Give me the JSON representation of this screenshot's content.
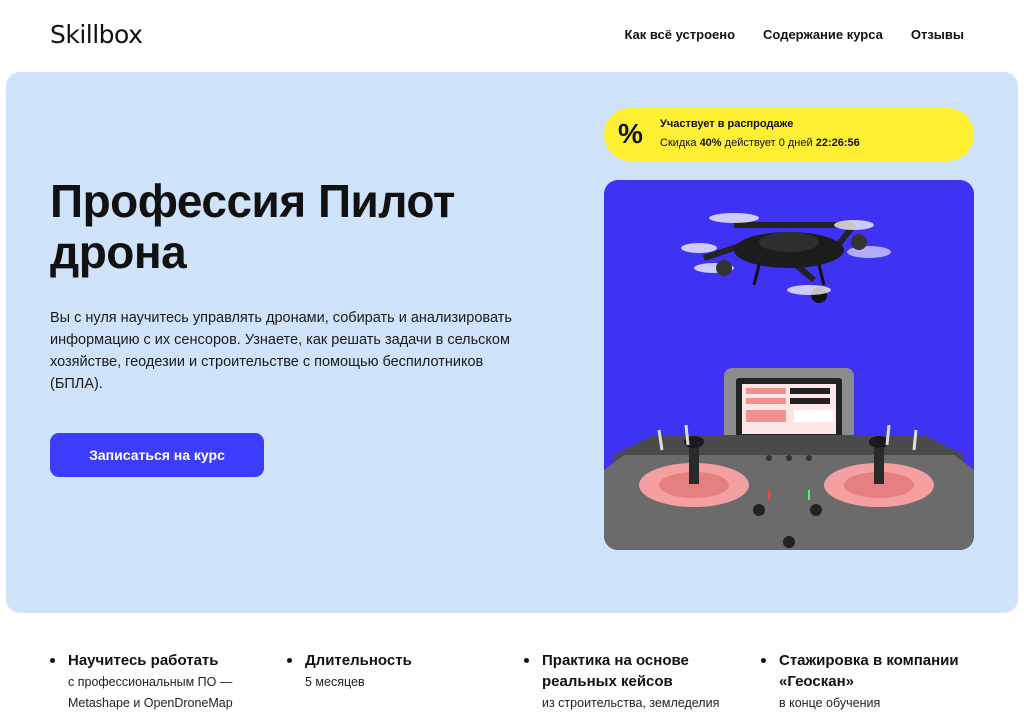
{
  "header": {
    "logo": "Skillbox",
    "nav": [
      {
        "label": "Как всё устроено"
      },
      {
        "label": "Содержание курса"
      },
      {
        "label": "Отзывы"
      }
    ]
  },
  "hero": {
    "title": "Профессия Пилот дрона",
    "description": "Вы с нуля научитесь управлять дронами, собирать и анализировать информацию с их сенсоров. Узнаете, как решать задачи в сельском хозяйстве, геодезии и строительстве с помощью беспилотников (БПЛА).",
    "cta_label": "Записаться на курс",
    "background_color": "#cfe4fb",
    "cta_color": "#3d3dff"
  },
  "sale": {
    "icon": "percent-icon",
    "line1": "Участвует в распродаже",
    "line2_prefix": "Скидка",
    "discount": "40%",
    "line2_middle": "действует",
    "days": "0 дней",
    "timer": "22:26:56",
    "color": "#fff033"
  },
  "image": {
    "description_icon": "drone-illustration",
    "background_color": "#3e32f5"
  },
  "features": [
    {
      "title": "Научитесь работать",
      "text": "с профессиональным ПО — Metashape и OpenDroneMap"
    },
    {
      "title": "Длительность",
      "text": "5 месяцев"
    },
    {
      "title": "Практика на основе реальных кейсов",
      "text": "из строительства, земледелия"
    },
    {
      "title": "Стажировка в компании «Геоскан»",
      "text": "в конце обучения"
    }
  ]
}
